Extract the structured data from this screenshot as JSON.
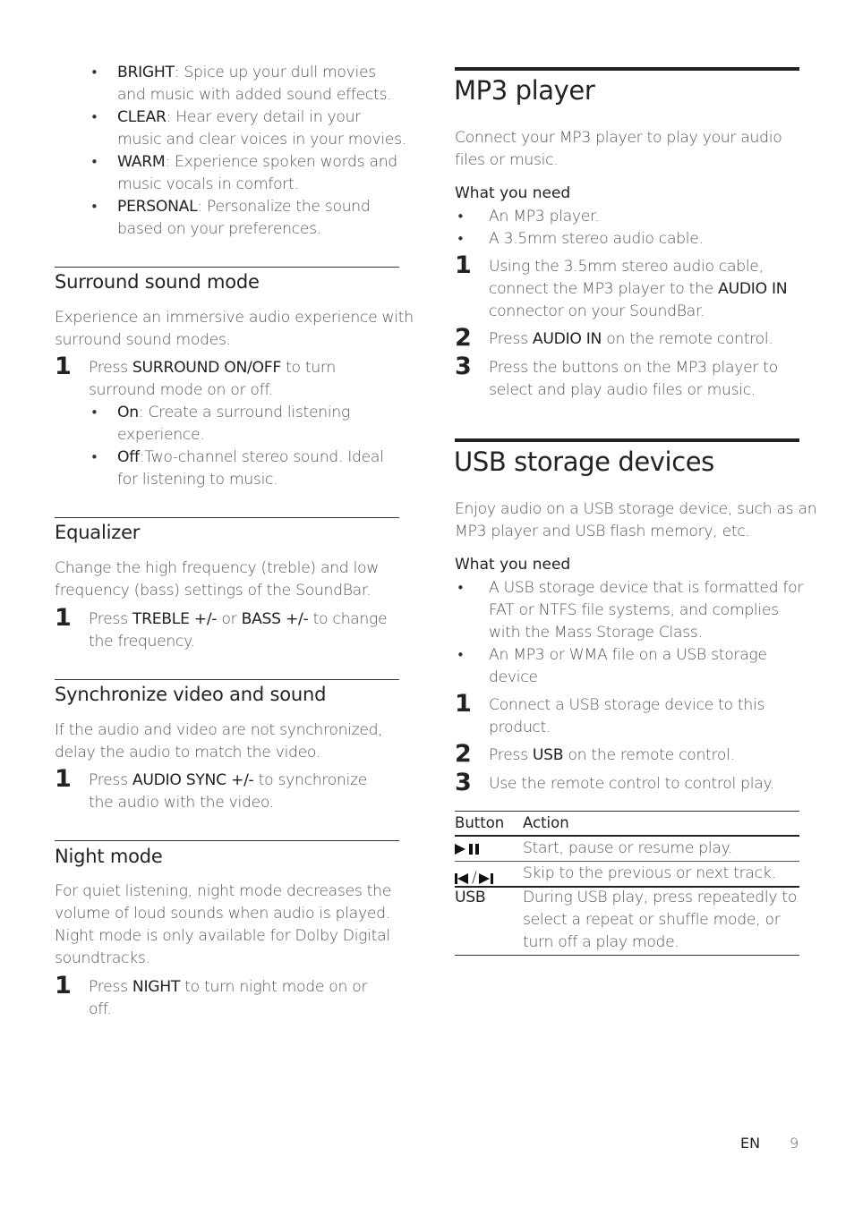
{
  "left": {
    "modes": [
      {
        "name": "BRIGHT",
        "lines": [
          ": Spice up your dull movies",
          "and music with added sound effects."
        ]
      },
      {
        "name": "CLEAR",
        "lines": [
          ": Hear every detail in your",
          "music and clear voices in your movies."
        ]
      },
      {
        "name": "WARM",
        "lines": [
          ": Experience spoken words and",
          "music vocals in comfort."
        ]
      },
      {
        "name": "PERSONAL",
        "lines": [
          ": Personalize the sound",
          "based on your preferences."
        ]
      }
    ],
    "surround": {
      "title": "Surround sound mode",
      "desc": [
        "Experience an immersive audio experience with",
        "surround sound modes."
      ],
      "step_num": "1",
      "step": {
        "pre": "Press ",
        "key": "SURROUND ON/OFF",
        "post": " to turn",
        "line2": "surround mode on or off."
      },
      "options": [
        {
          "name": "On",
          "lines": [
            ": Create a surround listening",
            "experience."
          ]
        },
        {
          "name": "Off",
          "lines": [
            ":Two-channel stereo sound. Ideal",
            "for listening to music."
          ]
        }
      ]
    },
    "equalizer": {
      "title": "Equalizer",
      "desc": [
        "Change the high frequency (treble) and low",
        "frequency (bass) settings of the SoundBar."
      ],
      "step_num": "1",
      "step": {
        "pre": "Press ",
        "key1": "TREBLE +/-",
        "mid": " or ",
        "key2": "BASS +/-",
        "post": " to change",
        "line2": "the frequency."
      }
    },
    "sync": {
      "title": "Synchronize video and sound",
      "desc": [
        "If the audio and video are not synchronized,",
        "delay the audio to match the video."
      ],
      "step_num": "1",
      "step": {
        "pre": "Press ",
        "key": "AUDIO SYNC +/-",
        "post": " to synchronize",
        "line2": "the audio with the video."
      }
    },
    "night": {
      "title": "Night mode",
      "desc": [
        "For quiet listening, night mode decreases the",
        "volume of loud sounds when audio is played.",
        "Night mode is only available for Dolby Digital",
        "soundtracks."
      ],
      "step_num": "1",
      "step": {
        "pre": "Press ",
        "key": "NIGHT",
        "post": " to turn night mode on or",
        "line2": "off."
      }
    }
  },
  "right": {
    "mp3": {
      "title": "MP3 player",
      "desc": [
        "Connect your MP3 player to play your audio",
        "files or music."
      ],
      "need_title": "What you need",
      "needs": [
        "An MP3 player.",
        "A 3.5mm stereo audio cable."
      ],
      "steps": [
        {
          "num": "1",
          "l1": "Using the 3.5mm stereo audio cable,",
          "l2pre": "connect the MP3 player to the ",
          "l2key": "AUDIO IN",
          "l3": "connector on your SoundBar."
        },
        {
          "num": "2",
          "pre": "Press ",
          "key": "AUDIO IN",
          "post": " on the remote control."
        },
        {
          "num": "3",
          "l1": "Press the buttons on the MP3 player to",
          "l2": "select and play audio files or music."
        }
      ]
    },
    "usb": {
      "title": "USB storage devices",
      "desc": [
        "Enjoy audio on a USB storage device, such as an",
        "MP3 player and USB flash memory, etc."
      ],
      "need_title": "What you need",
      "needs": [
        [
          "A USB storage device that is formatted for",
          "FAT or NTFS file systems, and complies",
          "with the Mass Storage Class."
        ],
        [
          "An MP3 or WMA file on a USB storage",
          "device"
        ]
      ],
      "steps": [
        {
          "num": "1",
          "l1": "Connect a USB storage device to this",
          "l2": "product."
        },
        {
          "num": "2",
          "pre": "Press ",
          "key": "USB",
          "post": " on the remote control."
        },
        {
          "num": "3",
          "l1": "Use the remote control to control play."
        }
      ],
      "table": {
        "headers": [
          "Button",
          "Action"
        ],
        "rows": [
          {
            "button_icon": "play-pause-icon",
            "action": [
              "Start, pause or resume play."
            ]
          },
          {
            "button_icon": "previous-next-icon",
            "sep": " / ",
            "action": [
              "Skip to the previous or next track."
            ]
          },
          {
            "button": "USB",
            "action": [
              "During USB play, press repeatedly to",
              "select a repeat or shuffle mode, or",
              "turn off a play mode."
            ]
          }
        ]
      }
    }
  },
  "footer": {
    "lang": "EN",
    "page": "9"
  }
}
